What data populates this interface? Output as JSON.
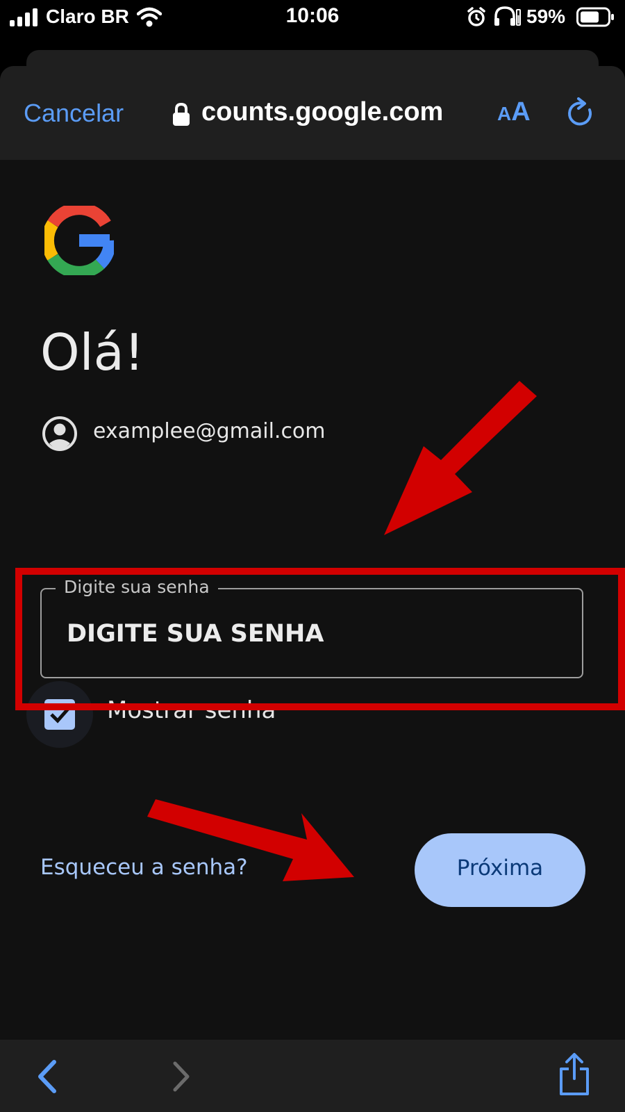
{
  "status_bar": {
    "carrier": "Claro BR",
    "time": "10:06",
    "battery_percent": "59%",
    "icons": [
      "signal-icon",
      "wifi-icon",
      "alarm-icon",
      "headphones-icon",
      "battery-icon"
    ]
  },
  "browser_header": {
    "cancel_label": "Cancelar",
    "url": "counts.google.com",
    "text_size_label": "AA",
    "icons": [
      "lock-icon",
      "reload-icon"
    ]
  },
  "page": {
    "logo": "google-logo",
    "greeting": "Olá!",
    "account_email": "examplee@gmail.com",
    "password_field": {
      "label": "Digite sua senha",
      "value": "DIGITE SUA SENHA"
    },
    "show_password": {
      "label": "Mostrar senha",
      "checked": true
    },
    "forgot_password_label": "Esqueceu a senha?",
    "next_button_label": "Próxima"
  },
  "bottom_toolbar": {
    "icons": [
      "back-arrow-icon",
      "forward-arrow-icon",
      "share-icon"
    ]
  },
  "colors": {
    "accent_blue": "#a8c7fa",
    "ios_blue": "#5b9cf6",
    "annotation_red": "#d20000",
    "background": "#111111"
  }
}
